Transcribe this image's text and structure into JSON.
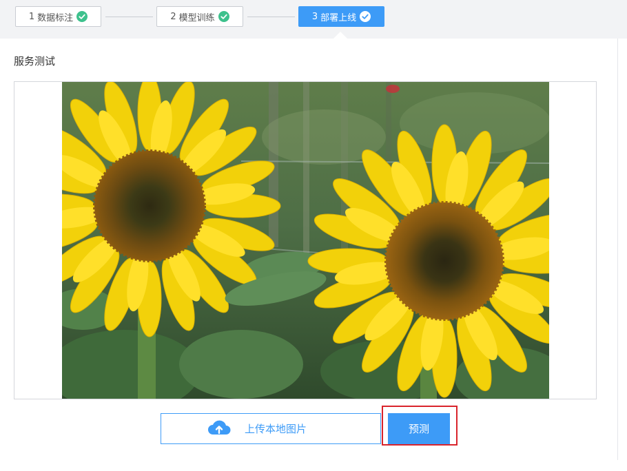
{
  "steps": [
    {
      "num": "1",
      "label": "数据标注",
      "status": "done"
    },
    {
      "num": "2",
      "label": "模型训练",
      "status": "done"
    },
    {
      "num": "3",
      "label": "部署上线",
      "status": "active"
    }
  ],
  "section": {
    "title": "服务测试"
  },
  "image": {
    "subject": "sunflowers"
  },
  "actions": {
    "upload_label": "上传本地图片",
    "predict_label": "预测"
  },
  "colors": {
    "accent": "#3d9bf7",
    "check_green": "#3ec18d",
    "highlight_red": "#d9232b"
  },
  "icons": {
    "step_check": "check-circle-icon",
    "upload": "cloud-upload-icon"
  }
}
